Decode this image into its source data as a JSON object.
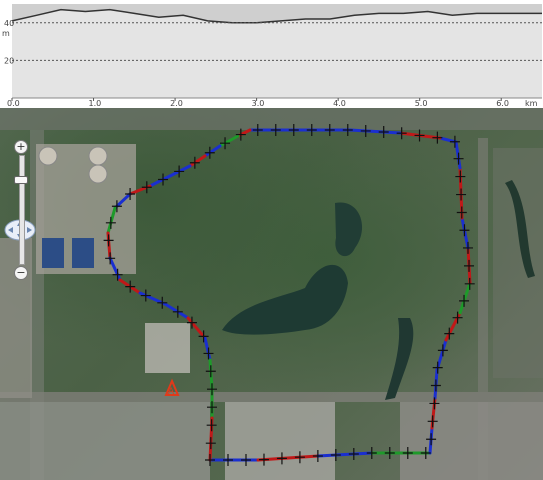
{
  "profile": {
    "y_axis_unit": "m",
    "y_tick_labels": [
      "40",
      "20"
    ],
    "x_tick_labels": [
      "0.0",
      "1.0",
      "2.0",
      "3.0",
      "4.0",
      "5.0",
      "6.0"
    ],
    "x_unit": "km"
  },
  "chart_data": {
    "type": "area",
    "xlabel": "km",
    "ylabel": "m",
    "xlim": [
      0,
      6.5
    ],
    "ylim": [
      0,
      50
    ],
    "x": [
      0,
      0.3,
      0.6,
      0.9,
      1.2,
      1.5,
      1.8,
      2.1,
      2.4,
      2.7,
      3.0,
      3.3,
      3.6,
      3.9,
      4.2,
      4.5,
      4.8,
      5.1,
      5.4,
      5.7,
      6.0,
      6.3,
      6.5
    ],
    "series": [
      {
        "color": "#333333",
        "values": [
          41,
          44,
          47,
          46,
          47,
          45,
          43,
          44,
          41,
          40,
          40,
          41,
          42,
          42,
          44,
          45,
          45,
          46,
          44,
          45,
          45,
          45,
          45
        ]
      }
    ]
  },
  "map": {
    "route_colors": [
      "#1a2fd0",
      "#c01818",
      "#1e9a2a"
    ],
    "marker_label": "A",
    "marker_color": "#e03a1a"
  },
  "controls": {
    "zoom_in_label": "+",
    "zoom_out_label": "−",
    "pan_icon": "pan-arrows-icon"
  }
}
